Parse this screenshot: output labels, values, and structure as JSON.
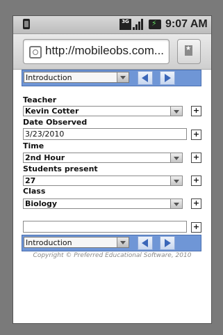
{
  "status_bar": {
    "network": "3G",
    "time": "9:07 AM"
  },
  "browser": {
    "url": "http://mobileobs.com..."
  },
  "form": {
    "section_select": "Introduction",
    "fields": [
      {
        "label": "Teacher",
        "value": "Kevin Cotter",
        "kind": "select"
      },
      {
        "label": "Date Observed",
        "value": "3/23/2010",
        "kind": "text"
      },
      {
        "label": "Time",
        "value": "2nd Hour",
        "kind": "select"
      },
      {
        "label": "Students present",
        "value": "27",
        "kind": "select"
      },
      {
        "label": "Class",
        "value": "Biology",
        "kind": "select"
      }
    ],
    "extra_field_value": "",
    "add_button_label": "+",
    "bottom_section_select": "Introduction"
  },
  "footer": {
    "copyright": "Copyright © Preferred Educational Software, 2010"
  },
  "colors": {
    "nav_bar": "#6f96d6",
    "nav_arrow": "#3a66b8"
  }
}
